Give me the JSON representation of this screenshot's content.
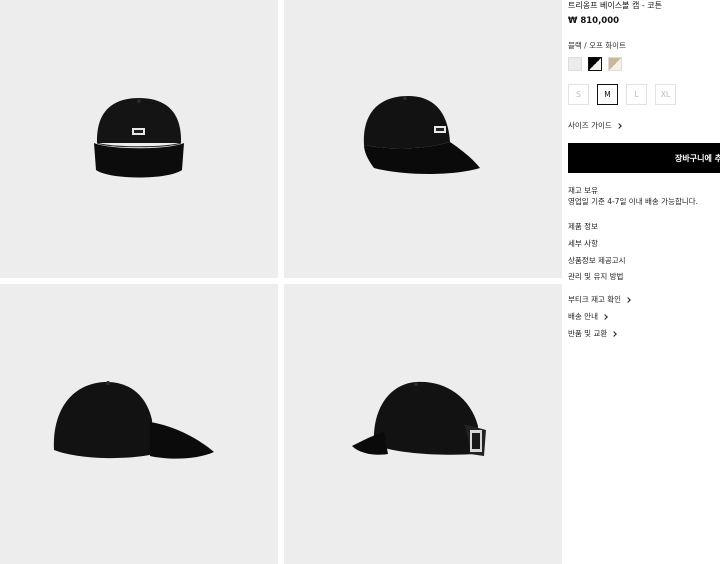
{
  "product": {
    "title": "트리옹프 베이스볼 캡 - 코튼",
    "price": "₩ 810,000"
  },
  "colors": {
    "label": "블랙 / 오프 화이트",
    "swatches": [
      {
        "name": "off-white",
        "hex": "#ececec"
      },
      {
        "name": "black-off-white",
        "hex": "#000000",
        "selected": true
      },
      {
        "name": "beige-off-white",
        "hex": "#c9b79a"
      }
    ]
  },
  "sizes": [
    {
      "label": "S",
      "selected": false
    },
    {
      "label": "M",
      "selected": true
    },
    {
      "label": "L",
      "selected": false
    },
    {
      "label": "XL",
      "selected": false
    }
  ],
  "size_guide": "사이즈 가이드",
  "add_to_cart": "장바구니에 추",
  "stock": {
    "status": "재고 보유",
    "delivery": "영업일 기준 4-7일 이내 배송 가능합니다."
  },
  "info_links": [
    "제품 정보",
    "세부 사항",
    "상품정보 제공고시",
    "관리 및 유지 방법"
  ],
  "service_links": [
    "부티크 재고 확인",
    "배송 안내",
    "반품 및 교환"
  ],
  "gallery": {
    "images": [
      "cap-front-view",
      "cap-three-quarter-view",
      "cap-left-side-view",
      "cap-back-view"
    ]
  }
}
